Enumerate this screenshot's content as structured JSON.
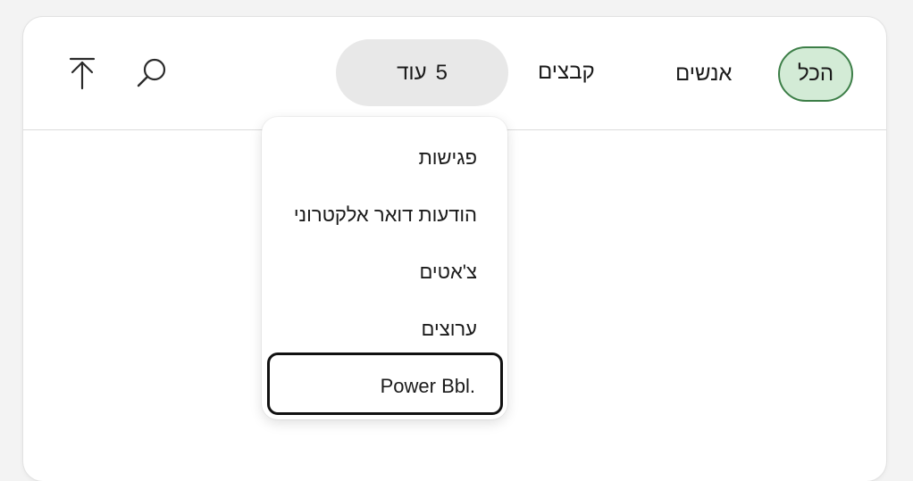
{
  "toolbar": {
    "tabs": {
      "all": "הכל",
      "people": "אנשים",
      "files": "קבצים",
      "more_count": "5",
      "more_label": "עוד"
    },
    "icons": {
      "search": "search-icon",
      "scroll_top": "arrow-up-to-line-icon"
    }
  },
  "more_menu": {
    "items": [
      "פגישות",
      "הודעות דואר אלקטרוני",
      "צ'אטים",
      "ערוצים",
      ".Power Bbl"
    ]
  },
  "colors": {
    "selected_tab_bg": "#d3ebd6",
    "selected_tab_border": "#3c7e47",
    "more_tab_bg": "#e8e8e8",
    "focus_ring": "#111111"
  }
}
